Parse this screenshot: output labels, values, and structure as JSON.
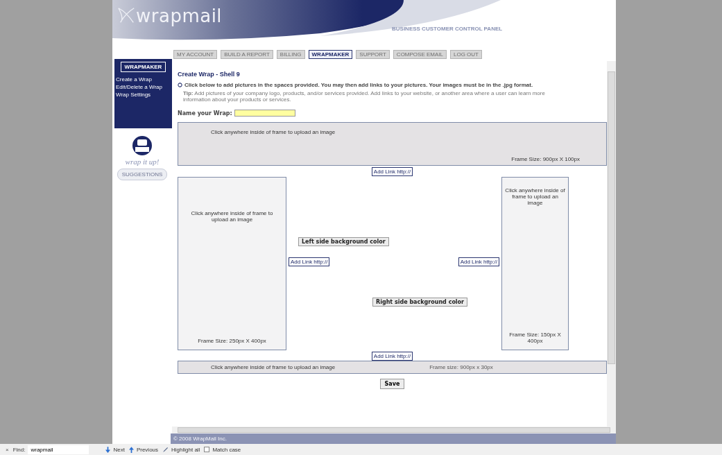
{
  "header": {
    "logo": "wrapmail",
    "subtitle": "BUSINESS CUSTOMER CONTROL PANEL"
  },
  "nav_tabs": [
    {
      "label": "MY ACCOUNT",
      "selected": false
    },
    {
      "label": "BUILD A REPORT",
      "selected": false
    },
    {
      "label": "BILLING",
      "selected": false
    },
    {
      "label": "WRAPMAKER",
      "selected": true
    },
    {
      "label": "SUPPORT",
      "selected": false
    },
    {
      "label": "COMPOSE EMAIL",
      "selected": false
    },
    {
      "label": "LOG OUT",
      "selected": false
    }
  ],
  "sidebar": {
    "heading": "WRAPMAKER",
    "items": [
      "Create a Wrap",
      "Edit/Delete a Wrap",
      "Wrap Settings"
    ],
    "tagline": "wrap it up!",
    "suggestions_button": "SUGGESTIONS"
  },
  "content": {
    "title": "Create Wrap - Shell 9",
    "instruction": "Click below to add pictures in the spaces provided. You may then add links to your pictures. Your images must be in the .jpg format.",
    "tip": "**Tip:** Add pictures of your company logo, products, and/or services provided. Add links to your website, or another area where a user can learn more information about your products or services.",
    "name_label": "Name your Wrap:",
    "top_frame": {
      "hint": "Click anywhere inside of frame to upload an image",
      "size": "Frame Size: 900px X 100px"
    },
    "top_link": "Add Link http://",
    "left_frame": {
      "hint": "Click anywhere inside of frame to upload an image",
      "size": "Frame Size: 250px X 400px"
    },
    "left_bg_button": "Left side background color",
    "left_link": "Add Link http://",
    "right_link": "Add Link http://",
    "right_bg_button": "Right side background color",
    "right_frame": {
      "hint": "Click anywhere inside of frame to upload an image",
      "size": "Frame Size: 150px X 400px"
    },
    "bottom_link": "Add Link http://",
    "bottom_frame": {
      "hint": "Click anywhere inside of frame to upload an image",
      "size": "Frame size: 900px x 30px"
    },
    "save_button": "Save"
  },
  "footer": "© 2008 WrapMail Inc.",
  "find_bar": {
    "close": "×",
    "label": "Find:",
    "value": "wrapmail",
    "next": "Next",
    "previous": "Previous",
    "highlight": "Highlight all",
    "match_case": {
      "label": "Match case",
      "checked": false
    }
  }
}
